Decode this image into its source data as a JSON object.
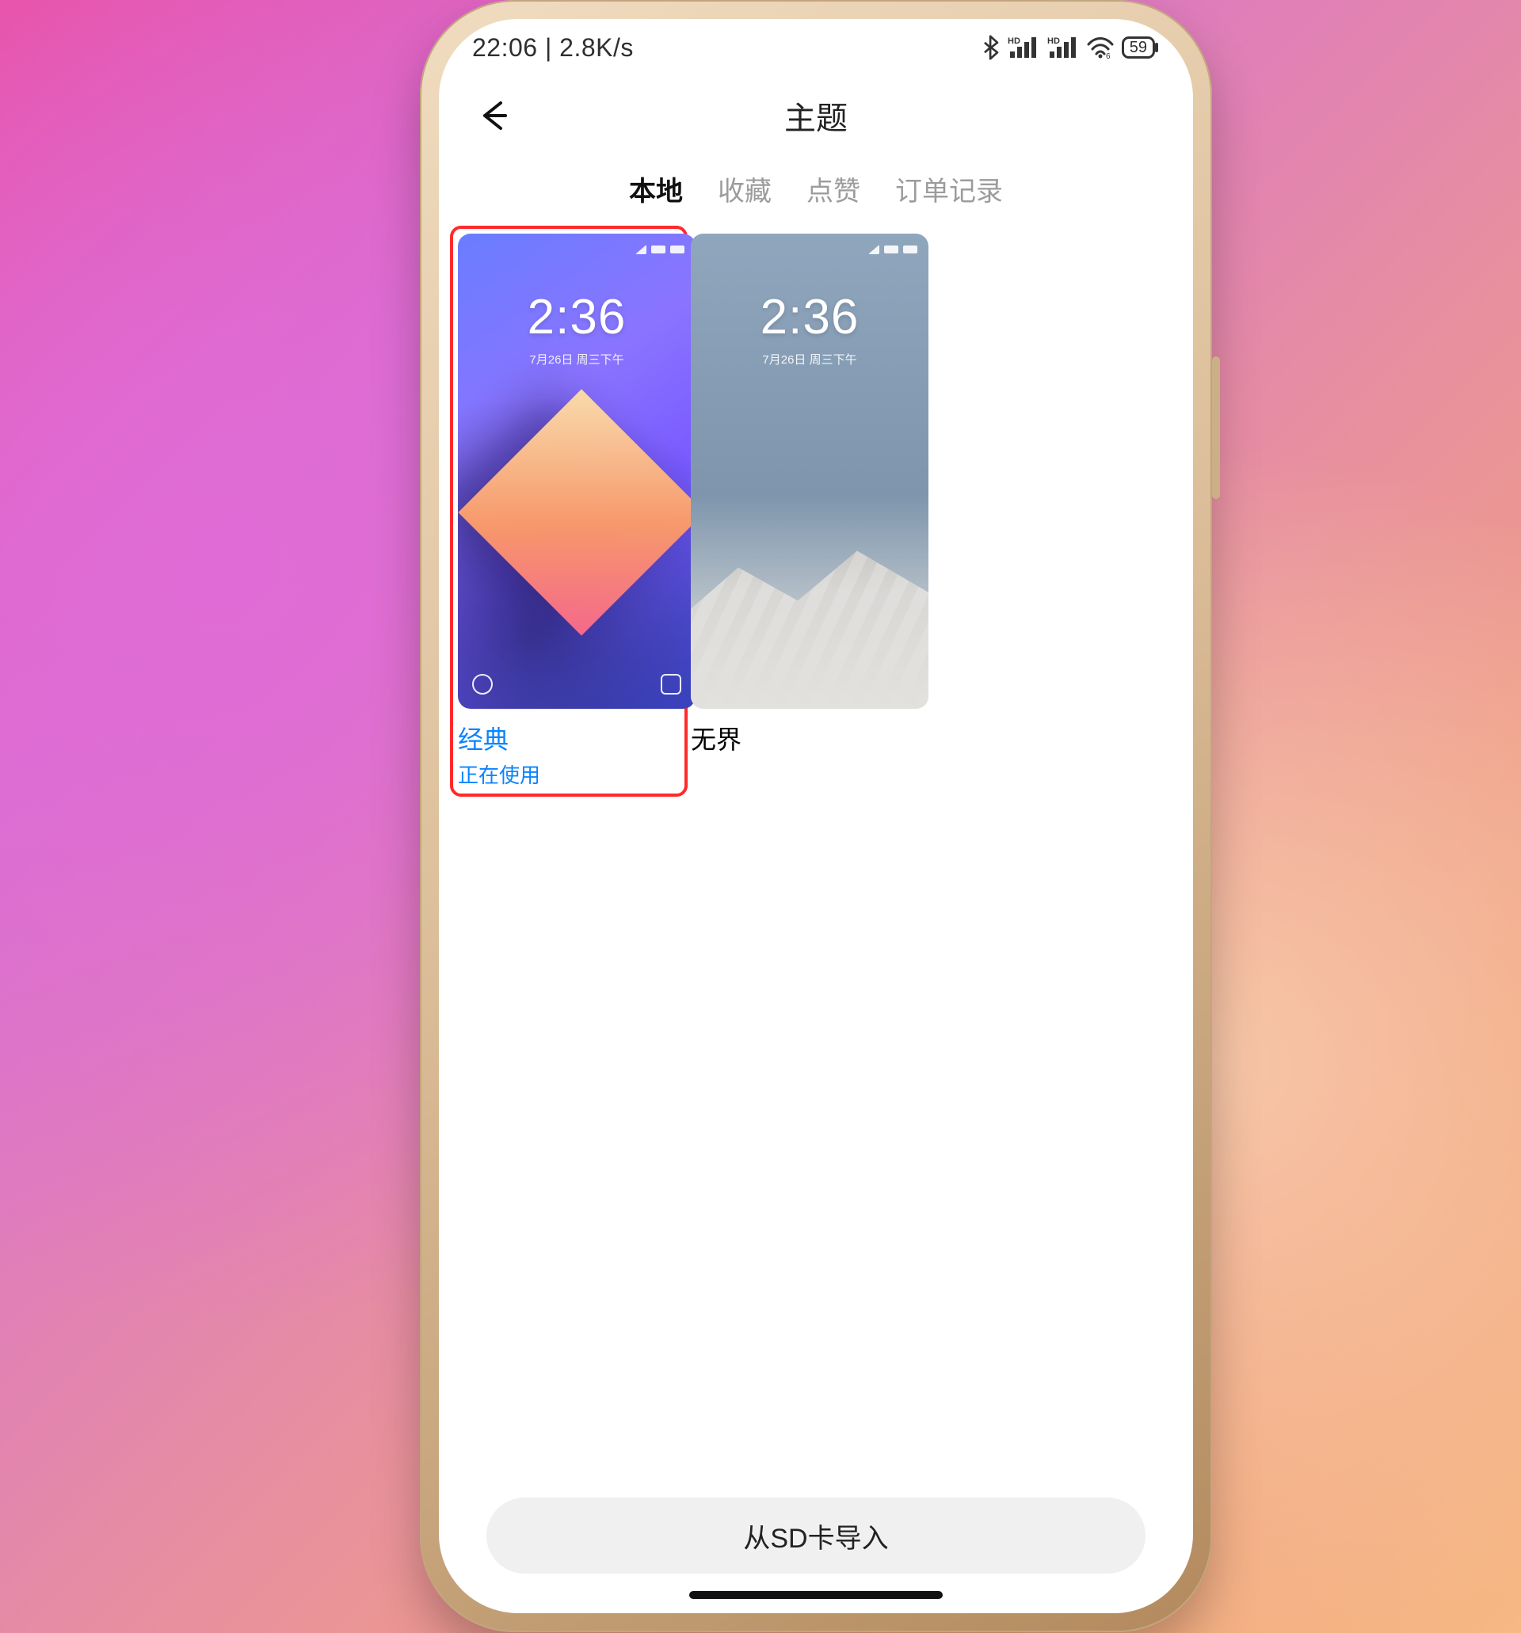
{
  "statusbar": {
    "time": "22:06",
    "speed": "2.8K/s",
    "battery": "59"
  },
  "header": {
    "title": "主题"
  },
  "tabs": [
    {
      "label": "本地",
      "active": true
    },
    {
      "label": "收藏",
      "active": false
    },
    {
      "label": "点赞",
      "active": false
    },
    {
      "label": "订单记录",
      "active": false
    }
  ],
  "themes": [
    {
      "name": "经典",
      "status": "正在使用",
      "selected": true,
      "lockscreen_time": "2:36",
      "lockscreen_date": "7月26日 周三下午"
    },
    {
      "name": "无界",
      "status": "",
      "selected": false,
      "lockscreen_time": "2:36",
      "lockscreen_date": "7月26日 周三下午"
    }
  ],
  "actions": {
    "import_from_sd": "从SD卡导入"
  }
}
